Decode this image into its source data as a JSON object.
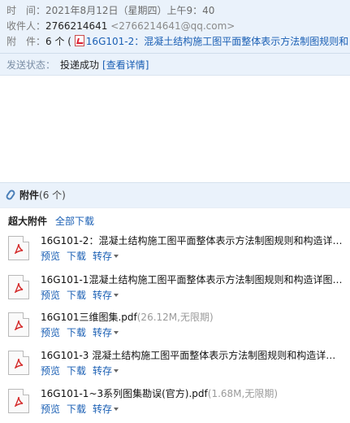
{
  "header": {
    "time_label": "时　间：",
    "time_value": "2021年8月12日（星期四）上午9：40",
    "from_label": "收件人：",
    "from_name": "2766214641",
    "from_email": "<2766214641@qq.com>",
    "attach_label": "附　件：",
    "attach_count": "6 个 (",
    "attach_first": "16G101-2：混凝土结构施工图平面整体表示方法制图规则和"
  },
  "status": {
    "label": "发送状态：",
    "value": "投递成功",
    "link": "[查看详情]"
  },
  "attachments": {
    "title": "附件",
    "count": "(6 个)",
    "big_label": "超大附件",
    "download_all": "全部下载",
    "preview_label": "预览",
    "download_label": "下载",
    "save_label": "转存",
    "items": [
      {
        "name": "16G101-2：混凝土结构施工图平面整体表示方法制图规则和构造详图...",
        "meta": ""
      },
      {
        "name": "16G101-1混凝土结构施工图平面整体表示方法制图规则和构造详图（...",
        "meta": ""
      },
      {
        "name": "16G101三维图集.pdf",
        "meta": "(26.12M,无限期)"
      },
      {
        "name": "16G101-3 混凝土结构施工图平面整体表示方法制图规则和构造详图....",
        "meta": ""
      },
      {
        "name": "16G101-1~3系列图集勘误(官方).pdf",
        "meta": "(1.68M,无限期)"
      }
    ]
  }
}
